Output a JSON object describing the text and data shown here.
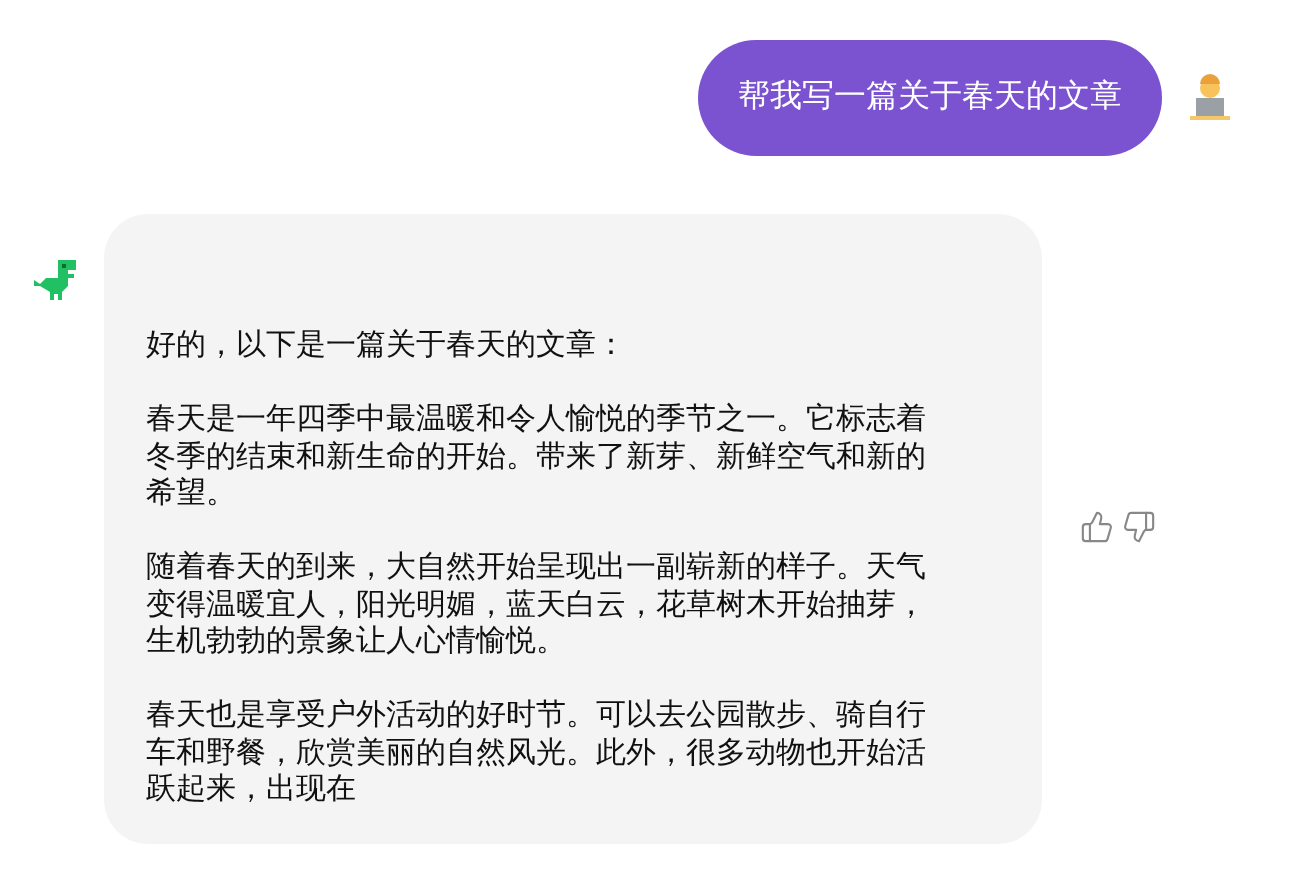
{
  "user_message": {
    "text": "帮我写一篇关于春天的文章"
  },
  "bot_message": {
    "paragraphs": [
      "好的，以下是一篇关于春天的文章：",
      "春天是一年四季中最温暖和令人愉悦的季节之一。它标志着冬季的结束和新生命的开始。带来了新芽、新鲜空气和新的希望。",
      "随着春天的到来，大自然开始呈现出一副崭新的样子。天气变得温暖宜人，阳光明媚，蓝天白云，花草树木开始抽芽，生机勃勃的景象让人心情愉悦。",
      "春天也是享受户外活动的好时节。可以去公园散步、骑自行车和野餐，欣赏美丽的自然风光。此外，很多动物也开始活跃起来，出现在"
    ]
  }
}
